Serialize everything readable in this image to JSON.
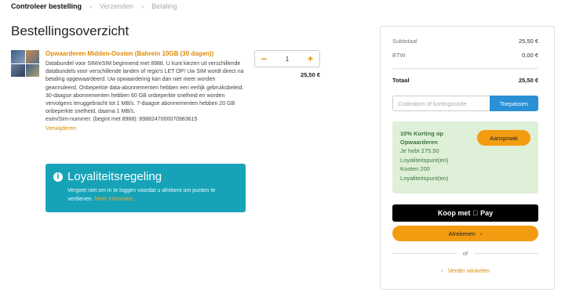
{
  "breadcrumb": {
    "steps": [
      "Controleer bestelling",
      "Verzenden",
      "Betaling"
    ],
    "separator": "›"
  },
  "page": {
    "title": "Bestellingsoverzicht"
  },
  "product": {
    "name": "Opwaarderen Midden-Oosten (Bahrein 10GB (30 dagen))",
    "description": "Databundel voor SIM/eSIM beginnend met 8988. U kunt kiezen uit verschillende databundels voor verschillende landen of regio's LET OP! Uw SIM wordt direct na betaling opgewaardeerd. Uw opwaardering kan dan niet meer worden geannuleerd. Onbeperkte data-abonnementen hebben een eerlijk gebruiksbeleid. 30-daagse abonnementen hebben 60 GB onbeperkte snelheid en worden vervolgens teruggebracht tot 1 MB/s. 7-daagse abonnementen hebben 20 GB onbeperkte snelheid, daarna 1 MB/s.",
    "sim_number": "esim/Sim-nummer: (begint met 8988): 8988247000070983615",
    "remove_label": "Verwijderen",
    "quantity": "1",
    "minus": "−",
    "plus": "+",
    "line_price": "25,50 €"
  },
  "loyalty": {
    "icon": "info-icon",
    "title": "Loyaliteitsregeling",
    "text": "Vergeet niet om in te loggen voordat u afrekent om punten te verdienen.",
    "link": "Meer informatie."
  },
  "summary": {
    "subtotal_label": "Subtotaal",
    "subtotal_value": "25,50 €",
    "tax_label": "BTW",
    "tax_value": "0,00 €",
    "total_label": "Totaal",
    "total_value": "25,50 €",
    "coupon_placeholder": "Codeabon of kortingscode",
    "coupon_button": "Toepassen",
    "promo": {
      "title": "10% Korting op Opwaarderen",
      "line1": "Je hebt 275.50",
      "line2": "Loyaliteitspunt(en)",
      "line3": "Kosten 200",
      "line4": "Loyaliteitspunt(en)",
      "button": "Aanspraak"
    },
    "applepay_label": "Koop met",
    "applepay_brand": "Pay",
    "checkout_label": "Afrekenen",
    "checkout_arrow": "›",
    "or_label": "of",
    "continue_arrow": "‹",
    "continue_label": "Verder winkelen"
  },
  "colors": {
    "accent": "#e08a00",
    "button_orange": "#f39c12",
    "loyalty_bg": "#16a3b8",
    "promo_bg": "#dff0d8",
    "apply_blue": "#2b8fd6"
  }
}
